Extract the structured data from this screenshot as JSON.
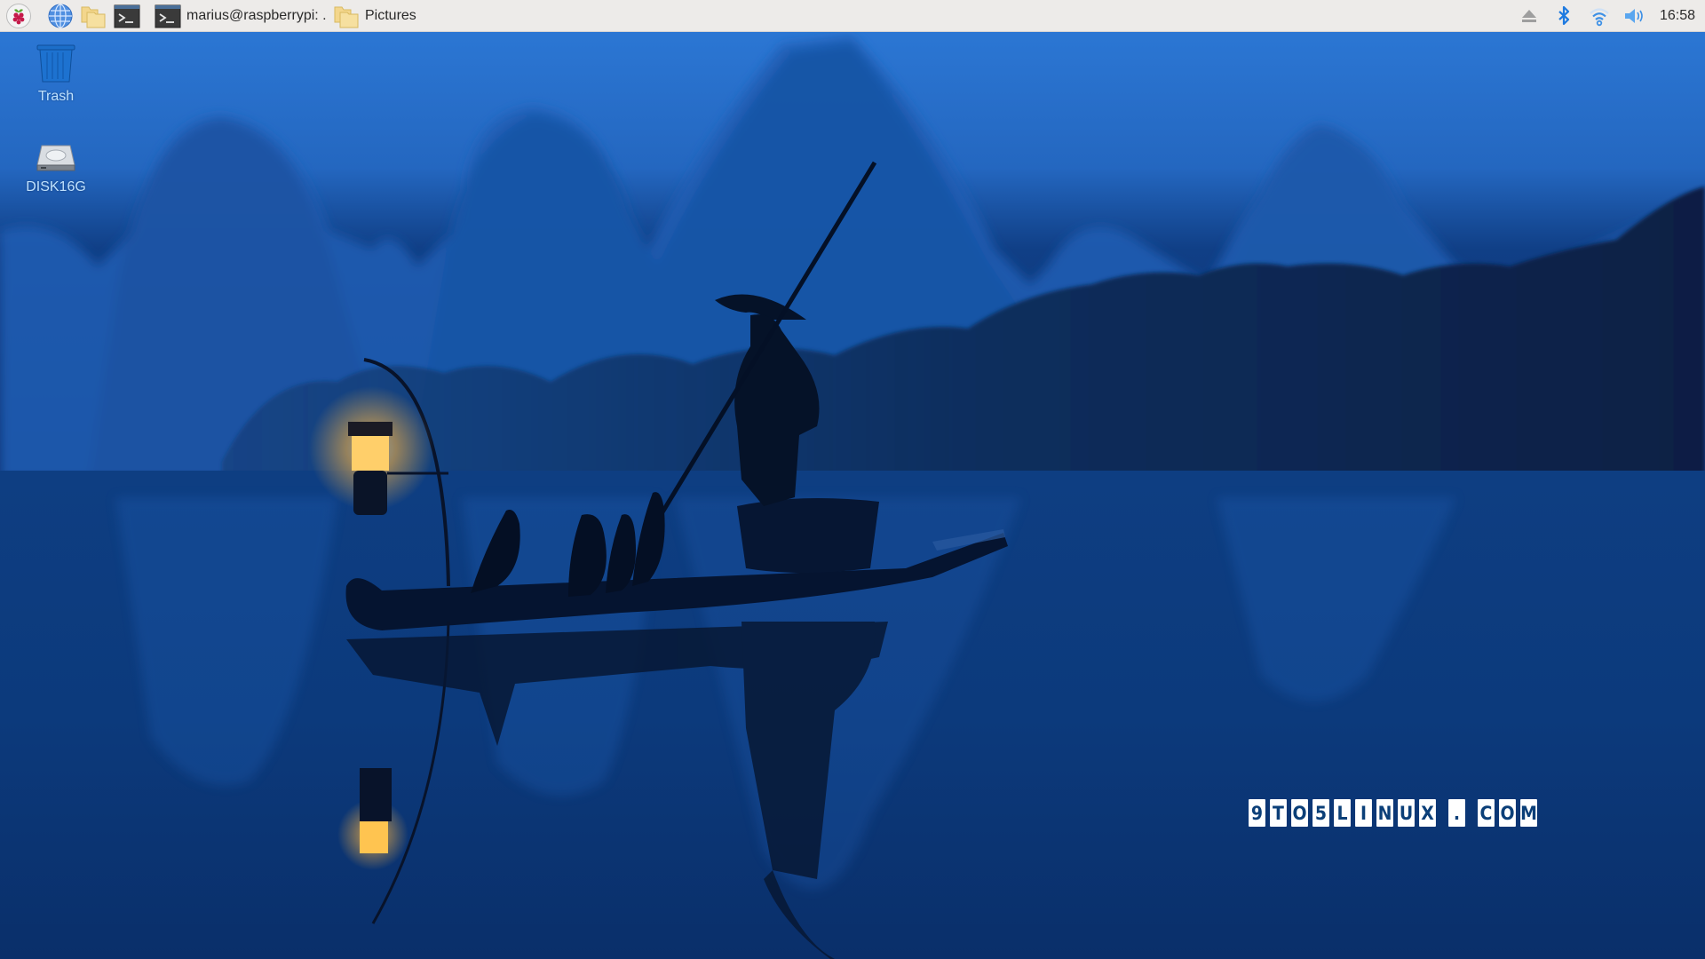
{
  "taskbar": {
    "launchers": [
      {
        "name": "menu",
        "icon": "raspberry-pi-menu-icon"
      },
      {
        "name": "browser",
        "icon": "web-browser-globe-icon"
      },
      {
        "name": "file-manager",
        "icon": "folder-icon"
      },
      {
        "name": "terminal",
        "icon": "terminal-icon"
      }
    ],
    "windows": [
      {
        "label": "marius@raspberrypi: .",
        "icon": "terminal-icon"
      },
      {
        "label": "Pictures",
        "icon": "folder-icon"
      }
    ],
    "tray": {
      "icons": [
        "eject-icon",
        "bluetooth-icon",
        "wifi-icon",
        "volume-icon"
      ],
      "clock": "16:58"
    }
  },
  "desktop": {
    "icons": [
      {
        "label": "Trash",
        "icon": "trash-icon"
      },
      {
        "label": "DISK16G",
        "icon": "hard-disk-icon"
      }
    ]
  },
  "wallpaper": {
    "description": "Fisherman on bamboo raft with lantern and cormorants, misty karst mountains at dusk",
    "watermark": [
      "9",
      "T",
      "O",
      "5",
      "L",
      "I",
      "N",
      "U",
      "X",
      ".",
      "C",
      "O",
      "M"
    ]
  },
  "colors": {
    "taskbar_bg": "#edebe9",
    "accent_blue": "#2a7fd9",
    "sky": "#2f7cd6",
    "water": "#0b3a7a",
    "lantern": "#ffcf6a"
  }
}
